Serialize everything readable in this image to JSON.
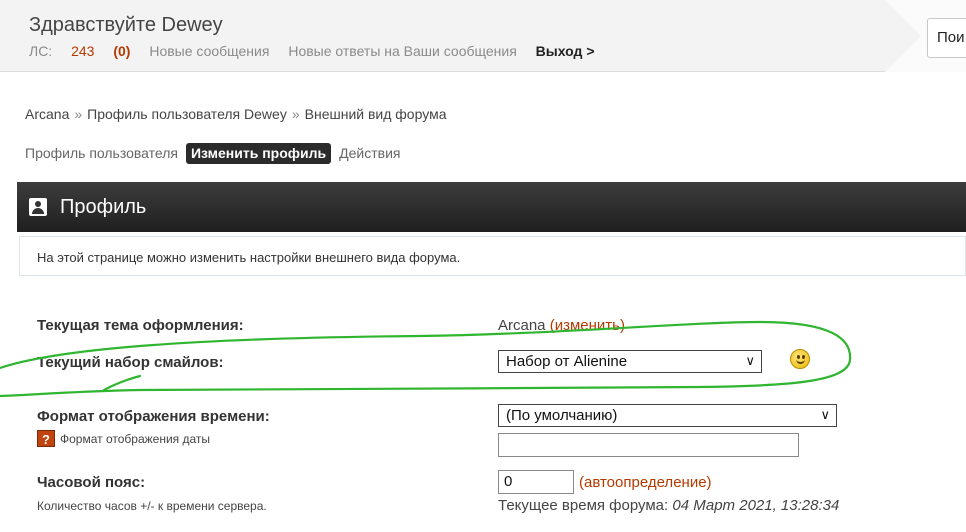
{
  "header": {
    "greeting": "Здравствуйте Dewey",
    "pm_label": "ЛС:",
    "pm_total": "243",
    "pm_new": "(0)",
    "new_messages": "Новые сообщения",
    "new_replies": "Новые ответы на Ваши сообщения",
    "logout": "Выход >",
    "search_button": "Пои"
  },
  "breadcrumb": {
    "items": [
      "Arcana",
      "Профиль пользователя Dewey",
      "Внешний вид форума"
    ],
    "separator": "»"
  },
  "tabs": [
    {
      "label": "Профиль пользователя",
      "active": false
    },
    {
      "label": "Изменить профиль",
      "active": true
    },
    {
      "label": "Действия",
      "active": false
    }
  ],
  "panel": {
    "title": "Профиль",
    "info": "На этой странице можно изменить настройки внешнего вида форума."
  },
  "settings": {
    "theme": {
      "label": "Текущая тема оформления:",
      "value": "Arcana",
      "change_link": "(изменить)"
    },
    "smileys": {
      "label": "Текущий набор смайлов:",
      "selected": "Набор от Alienine"
    },
    "time_format": {
      "label": "Формат отображения времени:",
      "help": "Формат отображения даты",
      "selected": "(По умолчанию)",
      "custom_value": ""
    },
    "timezone": {
      "label": "Часовой пояс:",
      "help": "Количество часов +/- к времени сервера.",
      "value": "0",
      "auto_link": "(автоопределение)",
      "current_time_label": "Текущее время форума:",
      "current_time": "04 Март 2021, 13:28:34"
    }
  },
  "colors": {
    "accent": "#b33a00",
    "bar": "#2b2b2b",
    "annotation": "#2fb52f"
  }
}
